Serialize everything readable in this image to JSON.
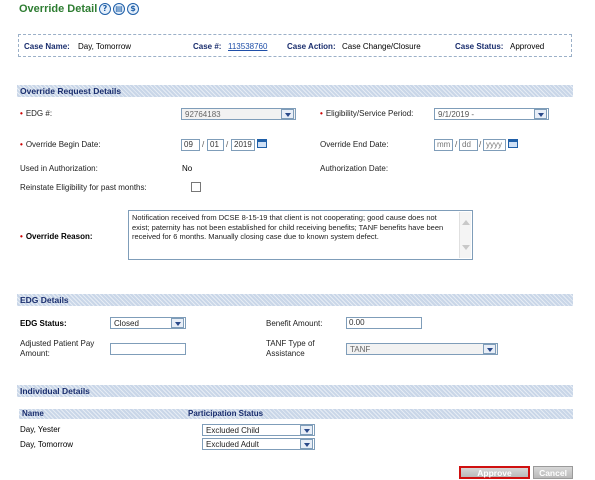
{
  "page": {
    "title": "Override Detail"
  },
  "title_icons": [
    {
      "name": "help-icon",
      "glyph": "?"
    },
    {
      "name": "document-icon",
      "glyph": "▤"
    },
    {
      "name": "dollar-icon",
      "glyph": "$"
    }
  ],
  "summary": {
    "case_name_label": "Case Name:",
    "case_name_value": "Day, Tomorrow",
    "case_num_label": "Case #:",
    "case_num_value": "113538760",
    "case_action_label": "Case Action:",
    "case_action_value": "Case Change/Closure",
    "case_status_label": "Case Status:",
    "case_status_value": "Approved"
  },
  "override_request": {
    "header": "Override Request Details",
    "edg_label": "EDG #:",
    "edg_value": "92764183",
    "eligibility_label": "Eligibility/Service Period:",
    "eligibility_value": "9/1/2019 -",
    "begin_label": "Override Begin Date:",
    "begin_mm": "09",
    "begin_dd": "01",
    "begin_yyyy": "2019",
    "end_label": "Override End Date:",
    "end_mm": "mm",
    "end_dd": "dd",
    "end_yyyy": "yyyy",
    "used_label": "Used in Authorization:",
    "used_value": "No",
    "auth_date_label": "Authorization Date:",
    "reinstate_label": "Reinstate Eligibility for past months:",
    "reason_label": "Override Reason:",
    "reason_value": "Notification received from DCSE 8-15-19 that client is not cooperating; good cause does not exist; paternity has not been established for child receiving benefits; TANF benefits have been received for 6 months.  Manually closing case due to known system defect."
  },
  "edg_details": {
    "header": "EDG Details",
    "status_label": "EDG Status:",
    "status_value": "Closed",
    "benefit_label": "Benefit Amount:",
    "benefit_value": "0.00",
    "adjusted_label_1": "Adjusted Patient Pay",
    "adjusted_label_2": "Amount:",
    "tanf_label_1": "TANF Type of",
    "tanf_label_2": "Assistance",
    "tanf_value": "TANF"
  },
  "individual_details": {
    "header": "Individual Details",
    "col_name": "Name",
    "col_status": "Participation Status",
    "rows": [
      {
        "name": "Day, Yester",
        "status": "Excluded Child"
      },
      {
        "name": "Day, Tomorrow",
        "status": "Excluded Adult"
      }
    ]
  },
  "actions": {
    "approve": "Approve",
    "cancel": "Cancel"
  },
  "colors": {
    "title_green": "#2e7d32",
    "header_blue": "#1a2e6e",
    "required_red": "#cc0000",
    "highlight_border": "#d01010"
  }
}
